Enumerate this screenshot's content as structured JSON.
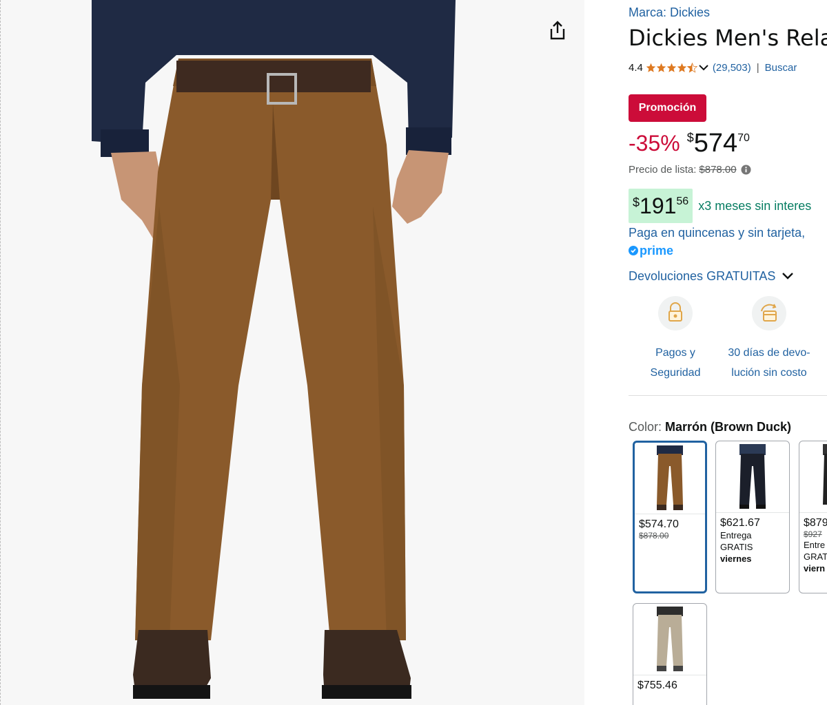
{
  "product": {
    "brand": "Marca: Dickies",
    "title": "Dickies Men's Relax",
    "rating": "4.4",
    "review_count": "(29,503)",
    "separator": "|",
    "search_link": "Buscar",
    "stars_value": 4.4
  },
  "pricing": {
    "promo_badge": "Promoción",
    "discount": "-35%",
    "currency": "$",
    "price_whole": "574",
    "price_fraction": "70",
    "list_label": "Precio de lista:",
    "list_price": "$878.00",
    "installment_currency": "$",
    "installment_whole": "191",
    "installment_fraction": "56",
    "installment_text": "x3 meses sin interes",
    "pay_link": "Paga en quincenas y sin tarjeta,",
    "prime": "prime",
    "returns": "Devoluciones GRATUITAS"
  },
  "features": [
    {
      "line1": "Pagos y",
      "line2": "Seguridad",
      "icon": "lock-payment-icon"
    },
    {
      "line1": "30 días de devo-",
      "line2": "lución sin costo",
      "icon": "return-box-icon"
    }
  ],
  "color": {
    "label": "Color:",
    "value": "Marrón (Brown Duck)"
  },
  "swatches": [
    {
      "price": "$574.70",
      "list": "$878.00",
      "delivery1": "",
      "delivery2": "",
      "delivery3": "",
      "color": "#8a5a2b"
    },
    {
      "price": "$621.67",
      "list": "",
      "delivery1": "Entrega",
      "delivery2": "GRATIS",
      "delivery3": "viernes",
      "color": "#1b1f2a"
    },
    {
      "price": "$879",
      "list": "$927",
      "delivery1": "Entre",
      "delivery2": "GRAT",
      "delivery3": "viern",
      "color": "#222222"
    },
    {
      "price": "$755.46",
      "list": "",
      "delivery1": "",
      "delivery2": "",
      "delivery3": "",
      "color": "#b9ad97"
    }
  ],
  "colors": {
    "link": "#2162a1",
    "deal_red": "#cc0c39",
    "star": "#de7921",
    "installment_bg": "#c7f3d6",
    "installment_text": "#067d62",
    "prime_blue": "#1a98ff",
    "pant_brown": "#8a5a2b",
    "shirt_navy": "#1f2a44"
  }
}
